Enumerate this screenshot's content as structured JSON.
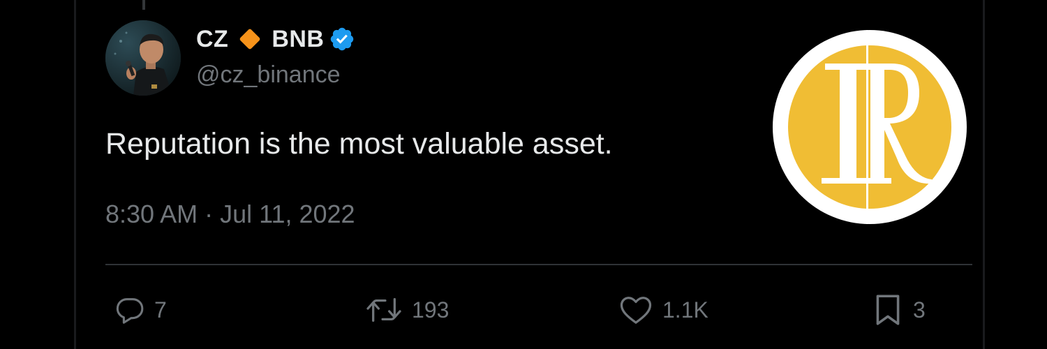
{
  "tweet": {
    "author": {
      "display_name_1": "CZ",
      "display_name_2": "BNB",
      "handle": "@cz_binance",
      "verified": true,
      "badge_icon": "diamond-icon",
      "verified_icon": "verified-badge-icon"
    },
    "text": "Reputation is the most valuable asset.",
    "timestamp": "8:30 AM · Jul 11, 2022",
    "stats": {
      "replies": "7",
      "retweets": "193",
      "likes": "1.1K",
      "bookmarks": "3"
    }
  },
  "colors": {
    "background": "#000000",
    "primary_text": "#e7e9ea",
    "secondary_text": "#71767b",
    "divider": "#2f3336",
    "verified_blue": "#1d9bf0",
    "diamond_orange": "#f7931a",
    "logo_gold": "#f0bd34"
  },
  "icons": {
    "reply": "reply-icon",
    "retweet": "retweet-icon",
    "like": "heart-icon",
    "bookmark": "bookmark-icon",
    "logo": "r-monogram-logo"
  }
}
